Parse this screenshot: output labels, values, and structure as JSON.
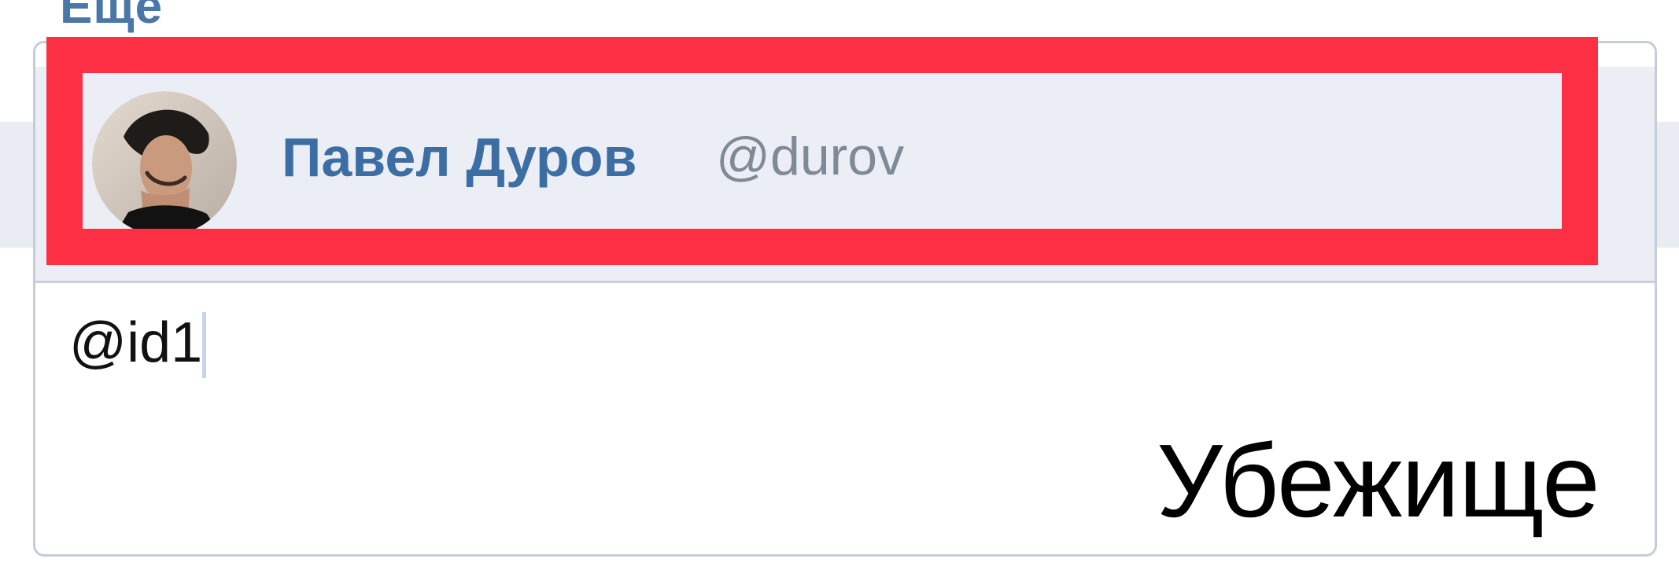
{
  "top": {
    "more_label": "Ещё"
  },
  "mention_suggestion": {
    "name": "Павел Дуров",
    "handle": "@durov",
    "avatar_icon": "user-avatar-photo"
  },
  "composer": {
    "value": "@id1"
  },
  "watermark": {
    "text": "Убежище"
  },
  "colors": {
    "link_blue": "#3d6ea3",
    "handle_gray": "#7f8a97",
    "highlight_red": "#fc2f45",
    "panel_bg": "#eceef5"
  }
}
